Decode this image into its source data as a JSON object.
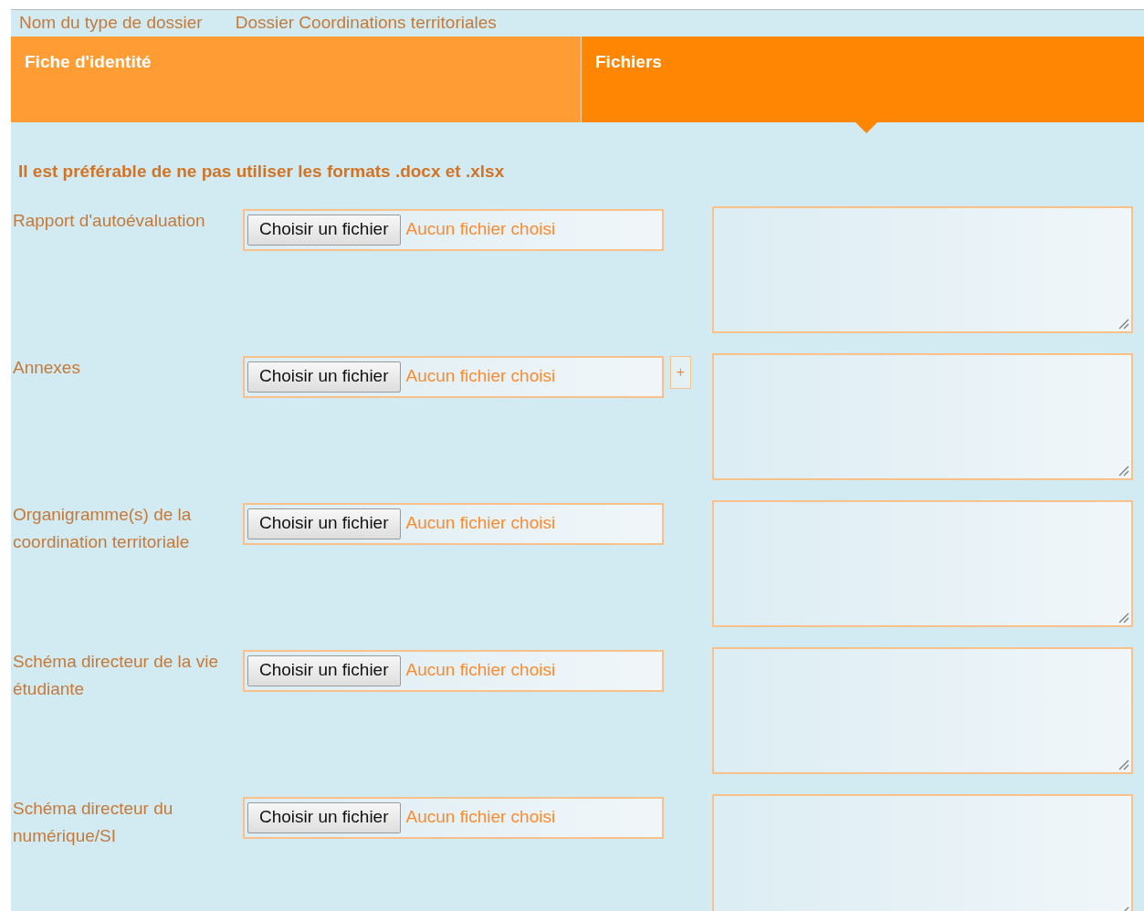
{
  "header": {
    "label": "Nom du type de dossier",
    "value": "Dossier Coordinations territoriales"
  },
  "tabs": [
    {
      "label": "Fiche d'identité",
      "selected": false
    },
    {
      "label": "Fichiers",
      "selected": true
    }
  ],
  "notice": "Il est préférable de ne pas utiliser les formats .docx et .xlsx",
  "rows": [
    {
      "kind": "single",
      "label": "Rapport d'autoévaluation",
      "button": "Choisir un fichier",
      "status": "Aucun fichier choisi"
    },
    {
      "kind": "multiple",
      "label": "Annexes",
      "button": "Choisir un fichier",
      "status": "Aucun fichier choisi",
      "add": "+"
    },
    {
      "kind": "single",
      "label": "Organigramme(s) de la coordination territoriale",
      "button": "Choisir un fichier",
      "status": "Aucun fichier choisi"
    },
    {
      "kind": "single",
      "label": "Schéma directeur de la vie étudiante",
      "button": "Choisir un fichier",
      "status": "Aucun fichier choisi"
    },
    {
      "kind": "single",
      "label": "Schéma directeur du numérique/SI",
      "button": "Choisir un fichier",
      "status": "Aucun fichier choisi"
    }
  ]
}
